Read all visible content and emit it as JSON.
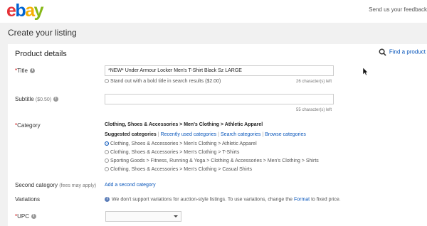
{
  "header": {
    "logo": {
      "e": "e",
      "b": "b",
      "a": "a",
      "y": "y"
    },
    "feedback_link": "Send us your feedback"
  },
  "page_title": "Create your listing",
  "product_details": {
    "heading": "Product details",
    "find_product": "Find a product",
    "title": {
      "label": "Title",
      "value": "*NEW* Under Armour Locker Men's T-Shirt Black Sz LARGE",
      "bold_option": "Stand out with a bold title in search results",
      "bold_price": "($2.00)",
      "chars_left": "26 character(s) left"
    },
    "subtitle": {
      "label": "Subtitle",
      "fee": "($0.50)",
      "value": "",
      "chars_left": "55 character(s) left"
    },
    "category": {
      "label": "Category",
      "selected_path": "Clothing, Shoes & Accessories > Men's Clothing > Athletic Apparel",
      "tabs": {
        "suggested": "Suggested categories",
        "recent": "Recently used categories",
        "search": "Search categories",
        "browse": "Browse categories"
      },
      "options": [
        "Clothing, Shoes & Accessories > Men's Clothing > Athletic Apparel",
        "Clothing, Shoes & Accessories > Men's Clothing > T-Shirts",
        "Sporting Goods > Fitness, Running & Yoga > Clothing & Accessories > Men's Clothing > Shirts",
        "Clothing, Shoes & Accessories > Men's Clothing > Casual Shirts"
      ]
    },
    "second_category": {
      "label": "Second category",
      "fee_note": "(fees may apply)",
      "link": "Add a second category"
    },
    "variations": {
      "label": "Variations",
      "note_before": "We don't support variations for auction-style listings. To use variations, change the",
      "note_link": "Format",
      "note_after": "to fixed price."
    },
    "upc": {
      "label": "UPC",
      "selected": ""
    }
  },
  "colors": {
    "ebay_e": "#e53238",
    "ebay_b": "#0064d2",
    "ebay_a": "#f5af02",
    "ebay_y": "#86b817",
    "link": "#0654ba"
  }
}
